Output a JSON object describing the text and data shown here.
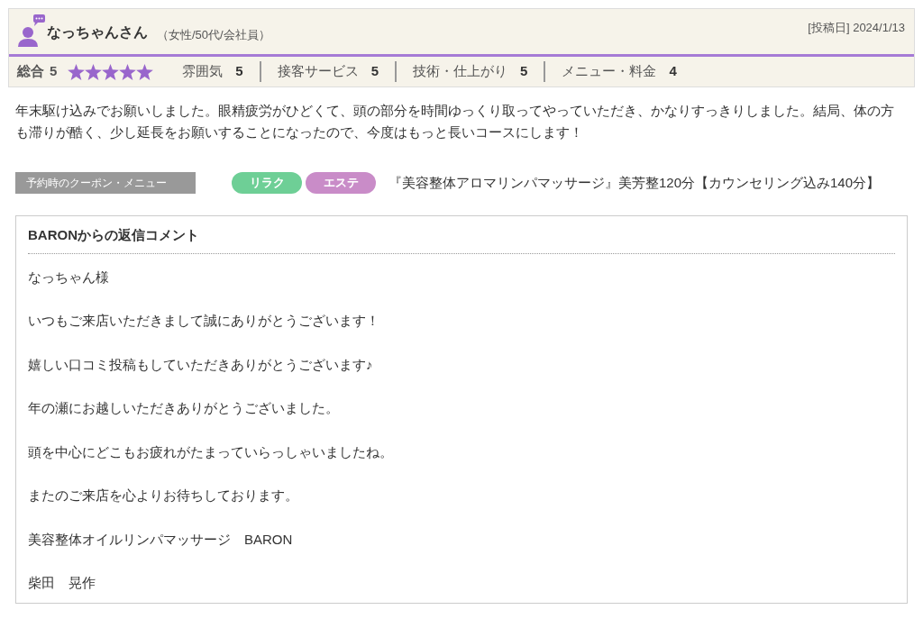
{
  "reviewer": {
    "name": "なっちゃんさん",
    "profile": "（女性/50代/会社員）",
    "posted": "[投稿日] 2024/1/13"
  },
  "ratings": {
    "overall_label": "総合",
    "overall_value": "5",
    "stars": 5,
    "items": [
      {
        "label": "雰囲気",
        "value": "5"
      },
      {
        "label": "接客サービス",
        "value": "5"
      },
      {
        "label": "技術・仕上がり",
        "value": "5"
      },
      {
        "label": "メニュー・料金",
        "value": "4"
      }
    ]
  },
  "comment": "年末駆け込みでお願いしました。眼精疲労がひどくて、頭の部分を時間ゆっくり取ってやっていただき、かなりすっきりしました。結局、体の方も滞りが酷く、少し延長をお願いすることになったので、今度はもっと長いコースにします！",
  "coupon": {
    "label": "予約時のクーポン・メニュー",
    "tags": [
      {
        "text": "リラク",
        "color": "#6ecf96"
      },
      {
        "text": "エステ",
        "color": "#c98cc8"
      }
    ],
    "menu": "『美容整体アロマリンパマッサージ』美芳整120分【カウンセリング込み140分】"
  },
  "reply": {
    "title": "BARONからの返信コメント",
    "paragraphs": [
      "なっちゃん様",
      "いつもご来店いただきまして誠にありがとうございます！",
      "嬉しい口コミ投稿もしていただきありがとうございます♪",
      "年の瀬にお越しいただきありがとうございました。",
      "頭を中心にどこもお疲れがたまっていらっしゃいましたね。",
      "またのご来店を心よりお待ちしております。",
      "美容整体オイルリンパマッサージ　BARON",
      "柴田　晃作"
    ]
  }
}
